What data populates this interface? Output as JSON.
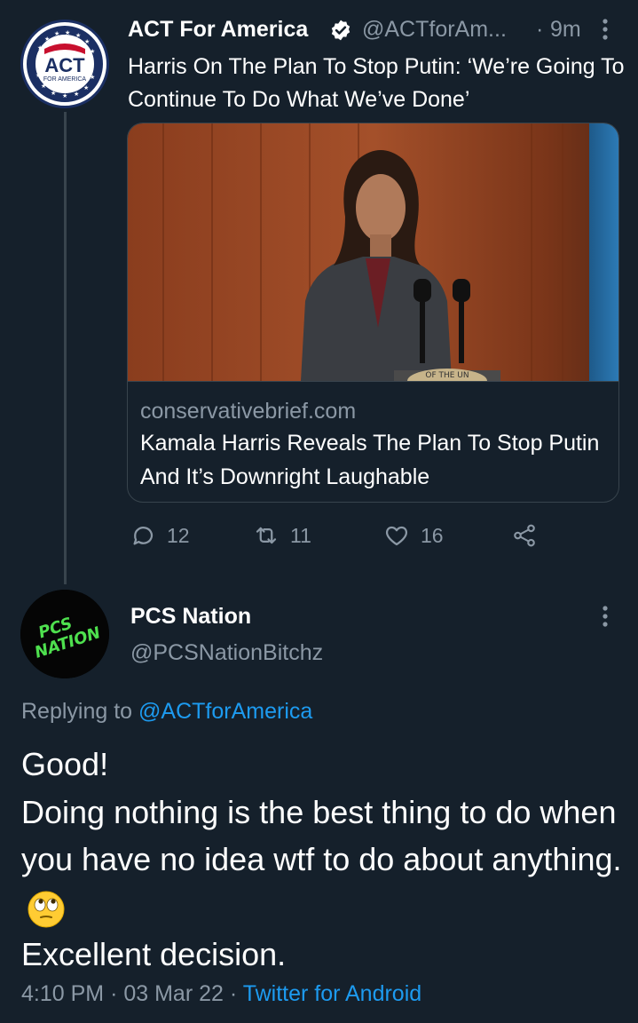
{
  "tweet": {
    "author": {
      "name": "ACT For America",
      "handle": "@ACTforAm...",
      "avatar_text": "ACT",
      "avatar_subtext": "FOR AMERICA"
    },
    "separator": "·",
    "time": "9m",
    "text": "Harris On The Plan To Stop Putin: ‘We’re Going To Continue To Do What We’ve Done’",
    "card": {
      "image_text": "OF THE UN",
      "domain": "conservativebrief.com",
      "title": "Kamala Harris Reveals The Plan To Stop Putin And It’s Downright Laughable"
    },
    "actions": {
      "replies": "12",
      "retweets": "11",
      "likes": "16"
    }
  },
  "reply": {
    "author": {
      "name": "PCS Nation",
      "handle": "@PCSNationBitchz",
      "avatar_text_line1": "PCS",
      "avatar_text_line2": "NATION"
    },
    "replying_to_label": "Replying to",
    "replying_to_handle": "@ACTforAmerica",
    "lines": [
      "Good!",
      "Doing nothing is the best thing to do when you have no idea wtf to do about anything.",
      "Excellent decision."
    ],
    "emoji": "face-with-rolling-eyes",
    "time": "4:10 PM",
    "date": "03 Mar 22",
    "separator": "·",
    "client": "Twitter for Android"
  },
  "colors": {
    "background": "#15202b",
    "text": "#ffffff",
    "muted": "#8b98a5",
    "accent": "#1d9bf0",
    "border": "#38444d"
  },
  "icons": [
    "verified-badge-icon",
    "more-icon",
    "reply-icon",
    "retweet-icon",
    "like-icon",
    "share-icon"
  ]
}
